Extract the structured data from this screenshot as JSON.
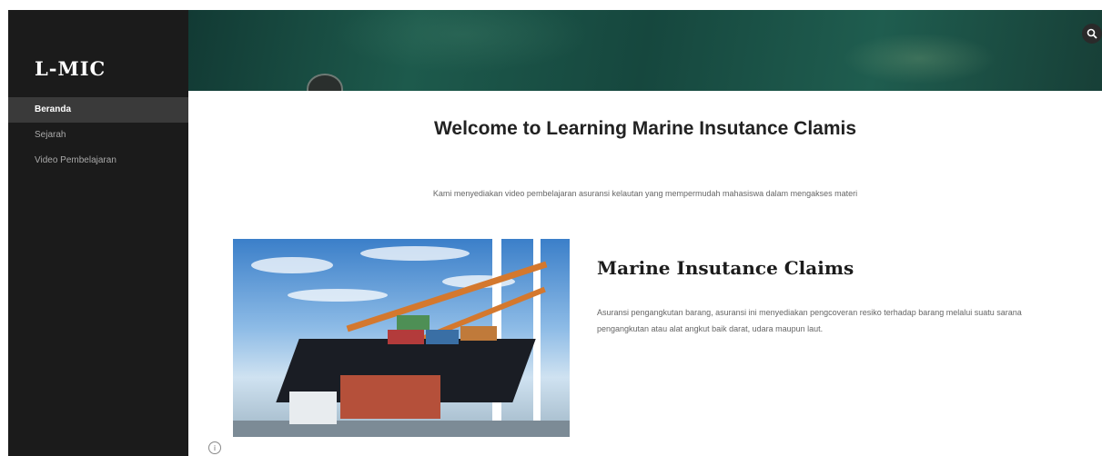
{
  "sidebar": {
    "logo": "L-MIC",
    "items": [
      {
        "label": "Beranda",
        "active": true
      },
      {
        "label": "Sejarah",
        "active": false
      },
      {
        "label": "Video Pembelajaran",
        "active": false
      }
    ]
  },
  "header": {
    "search_icon": "search-icon"
  },
  "main": {
    "title": "Welcome to Learning Marine Insutance Clamis",
    "intro": "Kami menyediakan video pembelajaran asuransi kelautan yang mempermudah mahasiswa dalam mengakses materi",
    "section": {
      "title": "Marine Insutance Claims",
      "text": "Asuransi pengangkutan barang, asuransi ini menyediakan pengcoveran resiko terhadap barang melalui suatu sarana pengangkutan atau alat angkut baik darat, udara maupun laut."
    },
    "info_icon": "info-icon"
  },
  "colors": {
    "sidebar_bg": "#1b1b1b",
    "active_item_bg": "#3a3a3a",
    "banner_teal": "#1d5a4c"
  }
}
